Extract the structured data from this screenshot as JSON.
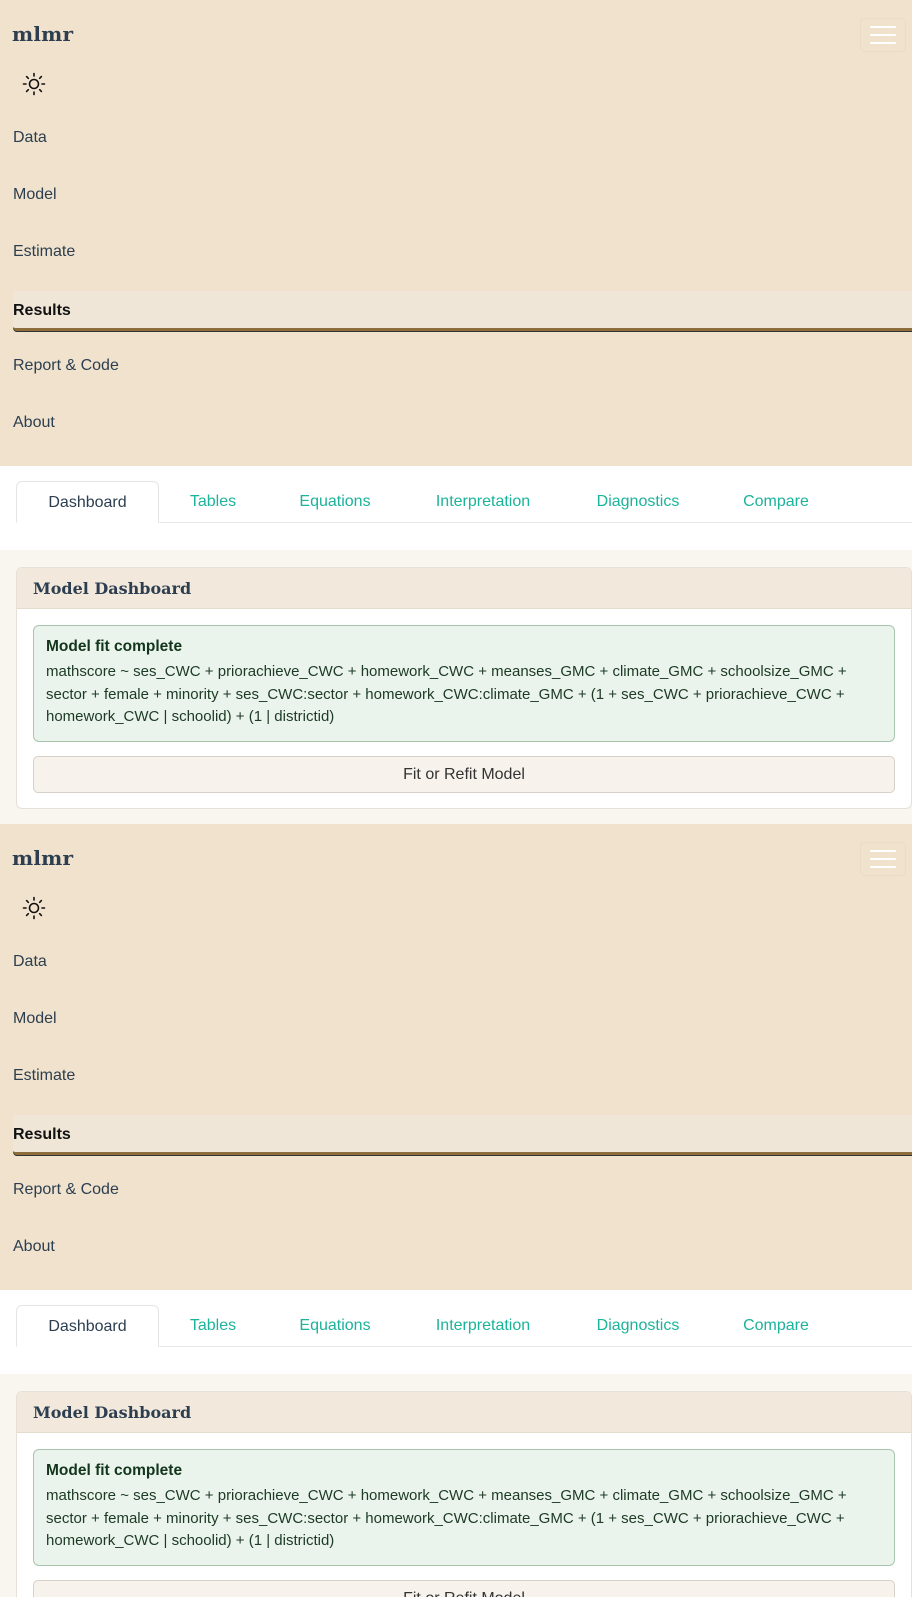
{
  "brand": "mlmr",
  "nav": {
    "items": [
      "Data",
      "Model",
      "Estimate",
      "Results",
      "Report & Code",
      "About"
    ],
    "active": "Results"
  },
  "tabs": [
    "Dashboard",
    "Tables",
    "Equations",
    "Interpretation",
    "Diagnostics",
    "Compare"
  ],
  "active_tab": "Dashboard",
  "card": {
    "title": "Model Dashboard",
    "alert_title": "Model fit complete",
    "alert_text": "mathscore ~ ses_CWC + priorachieve_CWC + homework_CWC + meanses_GMC + climate_GMC + schoolsize_GMC + sector + female + minority + ses_CWC:sector + homework_CWC:climate_GMC + (1 + ses_CWC + priorachieve_CWC + homework_CWC | schoolid) + (1 | districtid)",
    "button": "Fit or Refit Model"
  },
  "colors": {
    "navbar_bg": "#f0e2cc",
    "accent": "#1bb39a",
    "text": "#2c3e50",
    "alert_bg": "#eaf3ec"
  },
  "icons": [
    "sun-icon",
    "hamburger-menu-icon"
  ]
}
